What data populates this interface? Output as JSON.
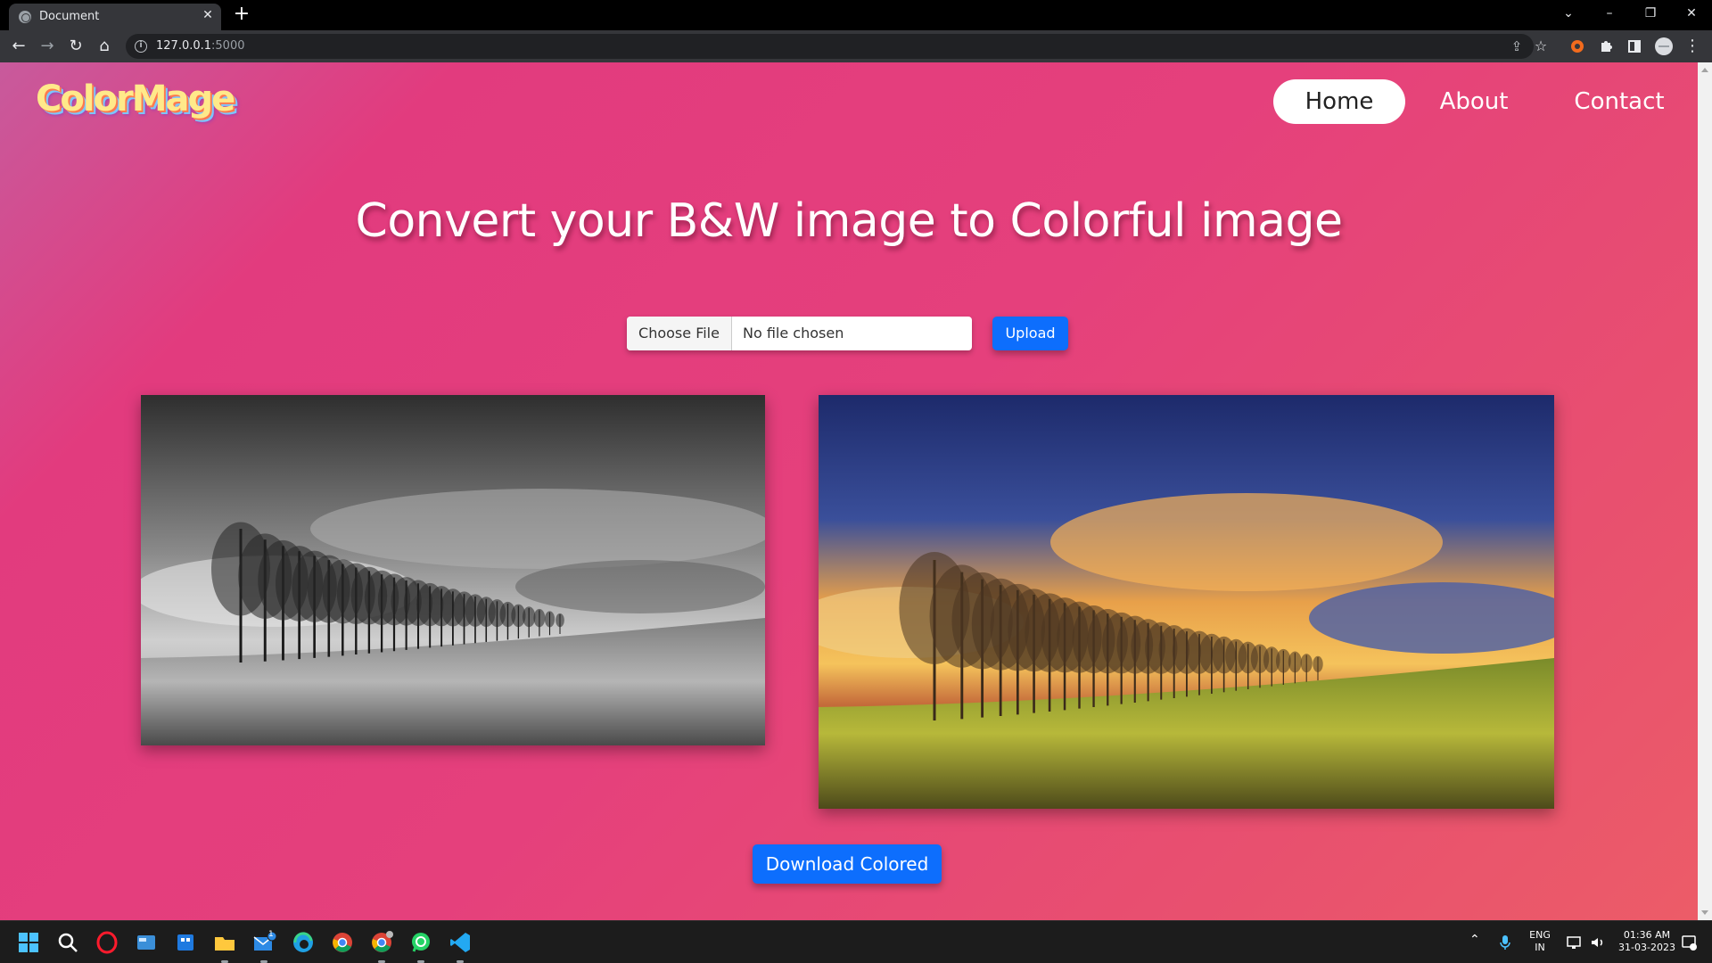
{
  "browser": {
    "tab_title": "Document",
    "url_host": "127.0.0.1",
    "url_port": ":5000"
  },
  "page": {
    "logo": "ColorMage",
    "nav": [
      {
        "label": "Home",
        "active": true
      },
      {
        "label": "About",
        "active": false
      },
      {
        "label": "Contact",
        "active": false
      }
    ],
    "headline": "Convert your B&W image to Colorful image",
    "file_input": {
      "button_label": "Choose File",
      "status": "No file chosen"
    },
    "upload_label": "Upload",
    "download_label": "Download Colored",
    "images": [
      {
        "kind": "grayscale",
        "subject": "row of bare trees on a hillside field under cloudy sky"
      },
      {
        "kind": "colorized",
        "subject": "row of bare trees on a hillside field under sunset sky"
      }
    ]
  },
  "colors": {
    "accent_button": "#0d6efd",
    "page_gradient_start": "#c85a9c",
    "page_gradient_end": "#ec5c68"
  },
  "taskbar": {
    "icons": [
      "windows-start-icon",
      "search-icon",
      "opera-icon",
      "widgets-icon",
      "store-icon",
      "file-explorer-icon",
      "mail-icon",
      "edge-icon",
      "chrome-icon",
      "chrome-canary-icon",
      "whatsapp-icon",
      "vscode-icon"
    ],
    "mail_badge": "1",
    "language": "ENG",
    "region": "IN",
    "time": "01:36 AM",
    "date": "31-03-2023"
  }
}
